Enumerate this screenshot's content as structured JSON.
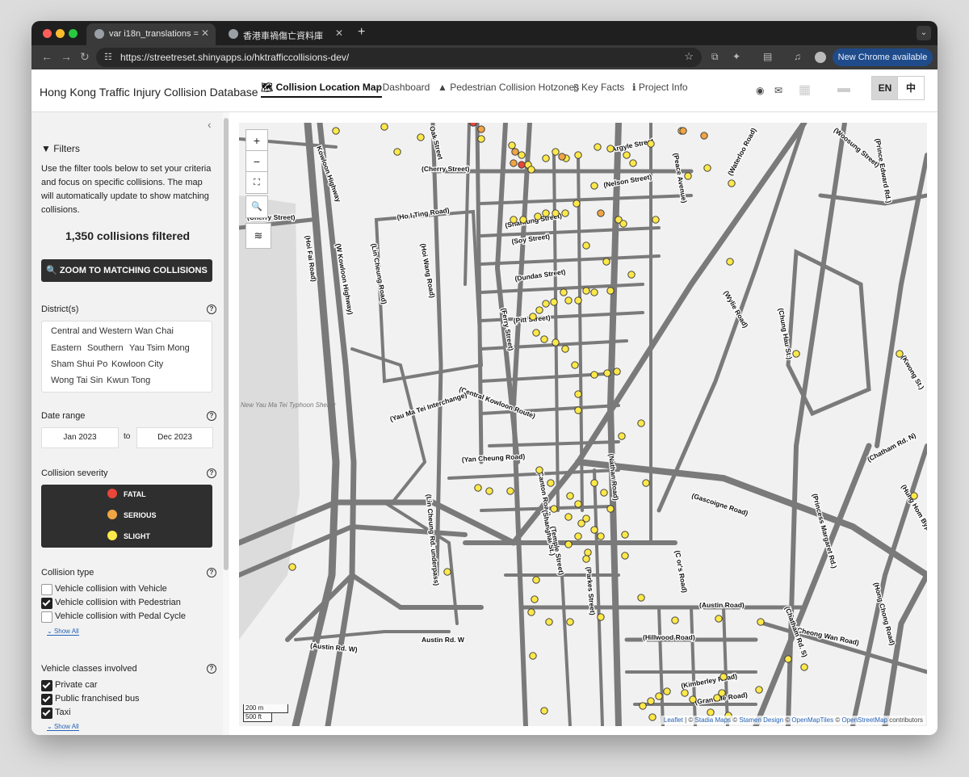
{
  "browser": {
    "tabs": [
      {
        "title": "var i18n_translations = [{\"zh\":",
        "active": true
      },
      {
        "title": "香港車禍傷亡資料庫",
        "active": false
      }
    ],
    "url": "https://streetreset.shinyapps.io/hktrafficcollisions-dev/",
    "new_chrome_label": "New Chrome available"
  },
  "app": {
    "title": "Hong Kong Traffic Injury Collision Database",
    "nav": [
      {
        "label": "Collision Location Map",
        "icon": "map-icon"
      },
      {
        "label": "Dashboard",
        "icon": "dashboard-icon"
      },
      {
        "label": "Pedestrian Collision Hotzones",
        "icon": "warning-icon"
      },
      {
        "label": "Key Facts",
        "icon": "document-icon"
      },
      {
        "label": "Project Info",
        "icon": "info-icon"
      }
    ],
    "lang": {
      "en": "EN",
      "zh": "中"
    }
  },
  "sidebar": {
    "filters_title": "Filters",
    "description": "Use the filter tools below to set your criteria and focus on specific collisions. The map will automatically update to show matching collisions.",
    "count_text": "1,350 collisions filtered",
    "zoom_button": "ZOOM TO MATCHING COLLISIONS",
    "district_label": "District(s)",
    "districts": [
      "Central and Western",
      "Wan Chai",
      "Eastern",
      "Southern",
      "Yau Tsim Mong",
      "Sham Shui Po",
      "Kowloon City",
      "Wong Tai Sin",
      "Kwun Tong"
    ],
    "date_label": "Date range",
    "date_from": "Jan 2023",
    "date_to_word": "to",
    "date_to": "Dec 2023",
    "severity_label": "Collision severity",
    "severity": [
      {
        "label": "FATAL",
        "color": "#e8473a"
      },
      {
        "label": "SERIOUS",
        "color": "#f0a444"
      },
      {
        "label": "SLIGHT",
        "color": "#fde84a"
      }
    ],
    "collision_type_label": "Collision type",
    "collision_types": [
      {
        "label": "Vehicle collision with Vehicle",
        "checked": false
      },
      {
        "label": "Vehicle collision with Pedestrian",
        "checked": true
      },
      {
        "label": "Vehicle collision with Pedal Cycle",
        "checked": false
      }
    ],
    "show_all": "Show All",
    "vehicle_label": "Vehicle classes involved",
    "vehicle_classes": [
      {
        "label": "Private car",
        "checked": true
      },
      {
        "label": "Public franchised bus",
        "checked": true
      },
      {
        "label": "Taxi",
        "checked": true
      }
    ]
  },
  "map": {
    "controls": {
      "zoom_in": "+",
      "zoom_out": "−"
    },
    "scale": {
      "metric": "200 m",
      "imperial": "500 ft"
    },
    "attribution": {
      "leaflet": "Leaflet",
      "sep": " | © ",
      "stadia": "Stadia Maps",
      "stamen": "Stamen Design",
      "omt": "OpenMapTiles",
      "osm": "OpenStreetMap",
      "tail": " contributors"
    },
    "road_labels": [
      "Kowloon Highway",
      "Oak Street",
      "(Cherry Street)",
      "Argyle Street",
      "(Nelson Street)",
      "(Ho I Ting Road)",
      "(Shantung Street)",
      "(Soy Street)",
      "(Dundas Street)",
      "(Pitt Street)",
      "(Lin Cheung Road)",
      "(W Kowloon Highway)",
      "(Hoi Wang Road)",
      "(Ferry Street)",
      "(Central Kowloon Route)",
      "(Yau Ma Tei Interchange)",
      "(Yan Cheung Road)",
      "(Canton Road)",
      "(Shanghai St.)",
      "(Nathan Road)",
      "(Gascoigne Road)",
      "(Princess Margaret Rd.)",
      "(Chatham Rd. N)",
      "(Hung Hom Bypass)",
      "(Austin Road)",
      "(Austin Rd. W)",
      "Austin Rd. W",
      "(Hillwood Road)",
      "(Kimberley Road)",
      "(Granville Road)",
      "(Cheong Wan Road)",
      "(Chatham Rd. S)",
      "(Hong Chong Road)",
      "(Waterloo Road)",
      "(Wylie Road)",
      "(Chung Hau St.)",
      "(Prince Edward Rd.)",
      "(Pei Ho Street)",
      "(Peace Avenue)",
      "(Parkes Street)",
      "(Lin Cheung Rd. underpass)",
      "(Kwong St.)",
      "(Hoi Fai Road)",
      "(Cherry Street)",
      "(Ivy Street)",
      "(Princess Margaret Rd.)",
      "(Kau Street)",
      "(Temple Street)",
      "(Woosung Street)",
      "(C or's Road)",
      "New Yau Ma Tei Typhoon Shelter"
    ]
  }
}
